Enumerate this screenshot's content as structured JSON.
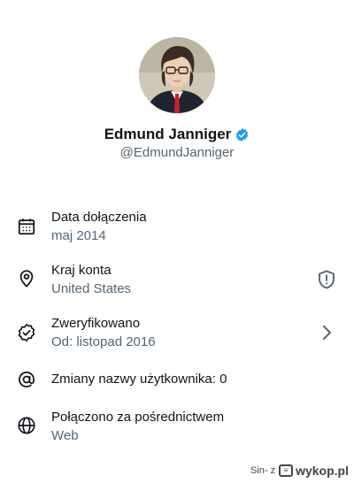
{
  "profile": {
    "name": "Edmund Janniger",
    "handle": "@EdmundJanniger",
    "verified_badge_color": "#1d9bf0"
  },
  "info": [
    {
      "icon": "calendar-icon",
      "title": "Data dołączenia",
      "subtitle": "maj 2014"
    },
    {
      "icon": "location-pin-icon",
      "title": "Kraj konta",
      "subtitle": "United States",
      "trailing_icon": "shield-alert-icon"
    },
    {
      "icon": "verified-badge-outline-icon",
      "title": "Zweryfikowano",
      "subtitle": "Od: listopad 2016",
      "trailing_icon": "chevron-right-icon"
    },
    {
      "icon": "at-sign-icon",
      "title": "Zmiany nazwy użytkownika: 0"
    },
    {
      "icon": "globe-icon",
      "title": "Połączono za pośrednictwem",
      "subtitle": "Web"
    }
  ],
  "watermark": {
    "user": "Sin- z",
    "site": "wykop.pl"
  },
  "colors": {
    "text_primary": "#0f1419",
    "text_secondary": "#536471",
    "accent": "#1d9bf0"
  }
}
